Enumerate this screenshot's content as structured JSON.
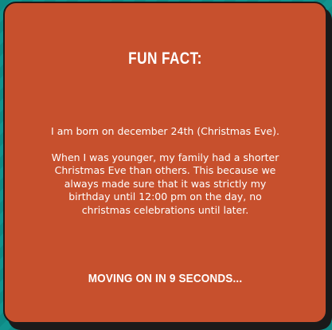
{
  "card": {
    "title": "FUN FACT:",
    "paragraphs": [
      "I am born on december 24th (Christmas Eve).",
      "When I was younger, my family had a shorter Christmas Eve than others. This because we always made sure that it was strictly my birthday until 12:00 pm on the day, no christmas celebrations until later."
    ],
    "countdown": "MOVING ON IN 9 SECONDS..."
  },
  "colors": {
    "background": "#0f8f8a",
    "card": "#c7502d",
    "text": "#ffffff"
  }
}
